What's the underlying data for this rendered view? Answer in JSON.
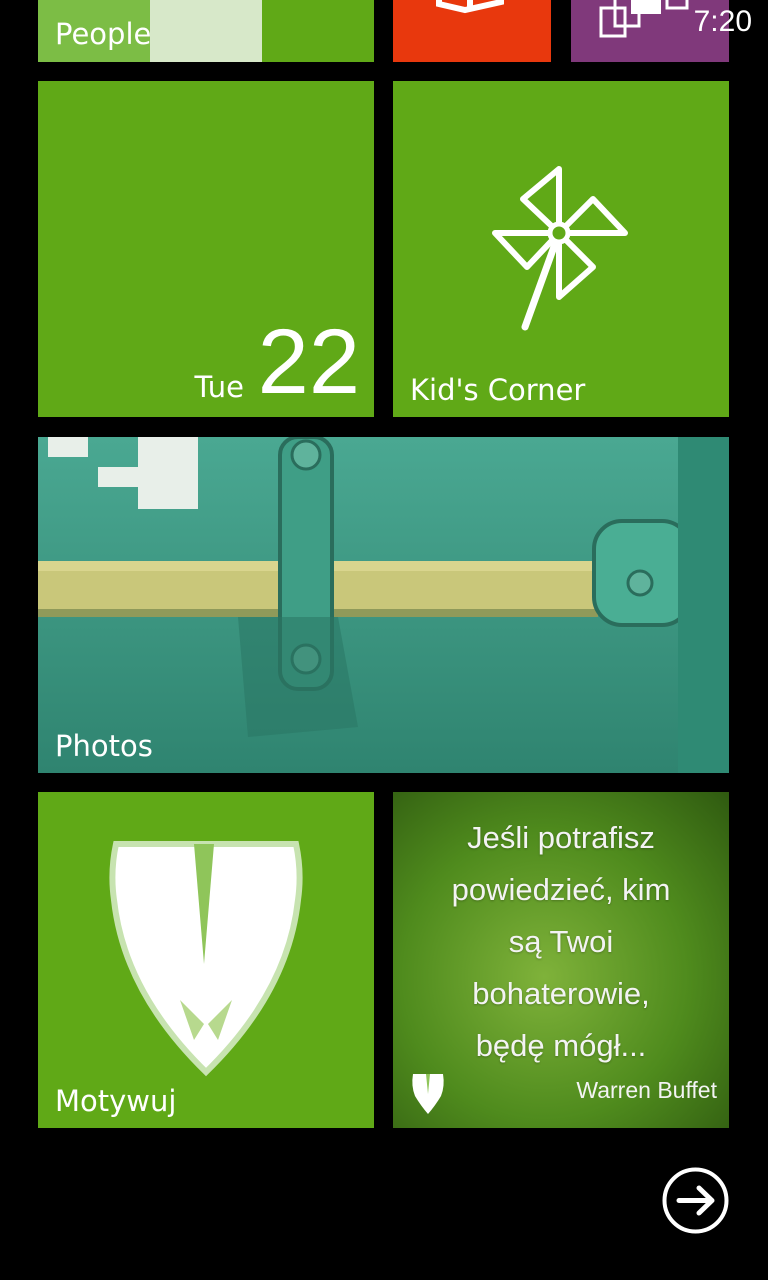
{
  "status_bar": {
    "time": "7:20"
  },
  "tiles": {
    "people": {
      "label": "People"
    },
    "office": {
      "icon": "office-icon",
      "color": "#e8380d"
    },
    "onenote": {
      "icon": "onenote-icon",
      "color": "#80397b"
    },
    "calendar": {
      "day": "Tue",
      "date": "22"
    },
    "kids_corner": {
      "label": "Kid's Corner",
      "icon": "pinwheel-icon"
    },
    "photos": {
      "label": "Photos"
    },
    "motywuj": {
      "label": "Motywuj",
      "icon": "shield-m-icon"
    },
    "quote": {
      "lines": [
        "Jeśli potrafisz",
        "powiedzieć, kim",
        "są Twoi",
        "bohaterowie,",
        "będę mógł..."
      ],
      "author": "Warren Buffet"
    }
  },
  "navigation": {
    "more_icon": "arrow-right-circle-icon"
  },
  "colors": {
    "tile_green": "#60a917",
    "background": "#000000"
  }
}
